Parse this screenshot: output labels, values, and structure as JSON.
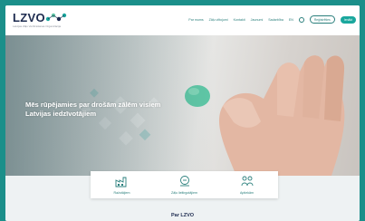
{
  "logo": {
    "text": "LZVO",
    "tagline": "Latvijas Zāļu Verificēšanas Organizācija"
  },
  "nav": {
    "items": [
      "Par mums",
      "Zāļu viltojumi",
      "Kontakti",
      "Jaunumi",
      "Sadarbība",
      "EN"
    ],
    "btn_outline": "Reģistrēties",
    "btn_solid": "Ienākt"
  },
  "hero": {
    "title": "Mēs rūpējamies par drošām zālēm visiem Latvijas iedzīvotājiem"
  },
  "cards": [
    {
      "label": "Ražotājiem",
      "icon": "factory-icon"
    },
    {
      "label": "Zāļu lieltirgotājiem",
      "icon": "truck-icon"
    },
    {
      "label": "Aptiekām",
      "icon": "people-icon"
    }
  ],
  "section": {
    "title": "Par LZVO"
  },
  "colors": {
    "frame": "#1b8f8a",
    "accent": "#2a7f7c",
    "brand": "#1d2b4f",
    "pill": "#5fc7a6"
  }
}
